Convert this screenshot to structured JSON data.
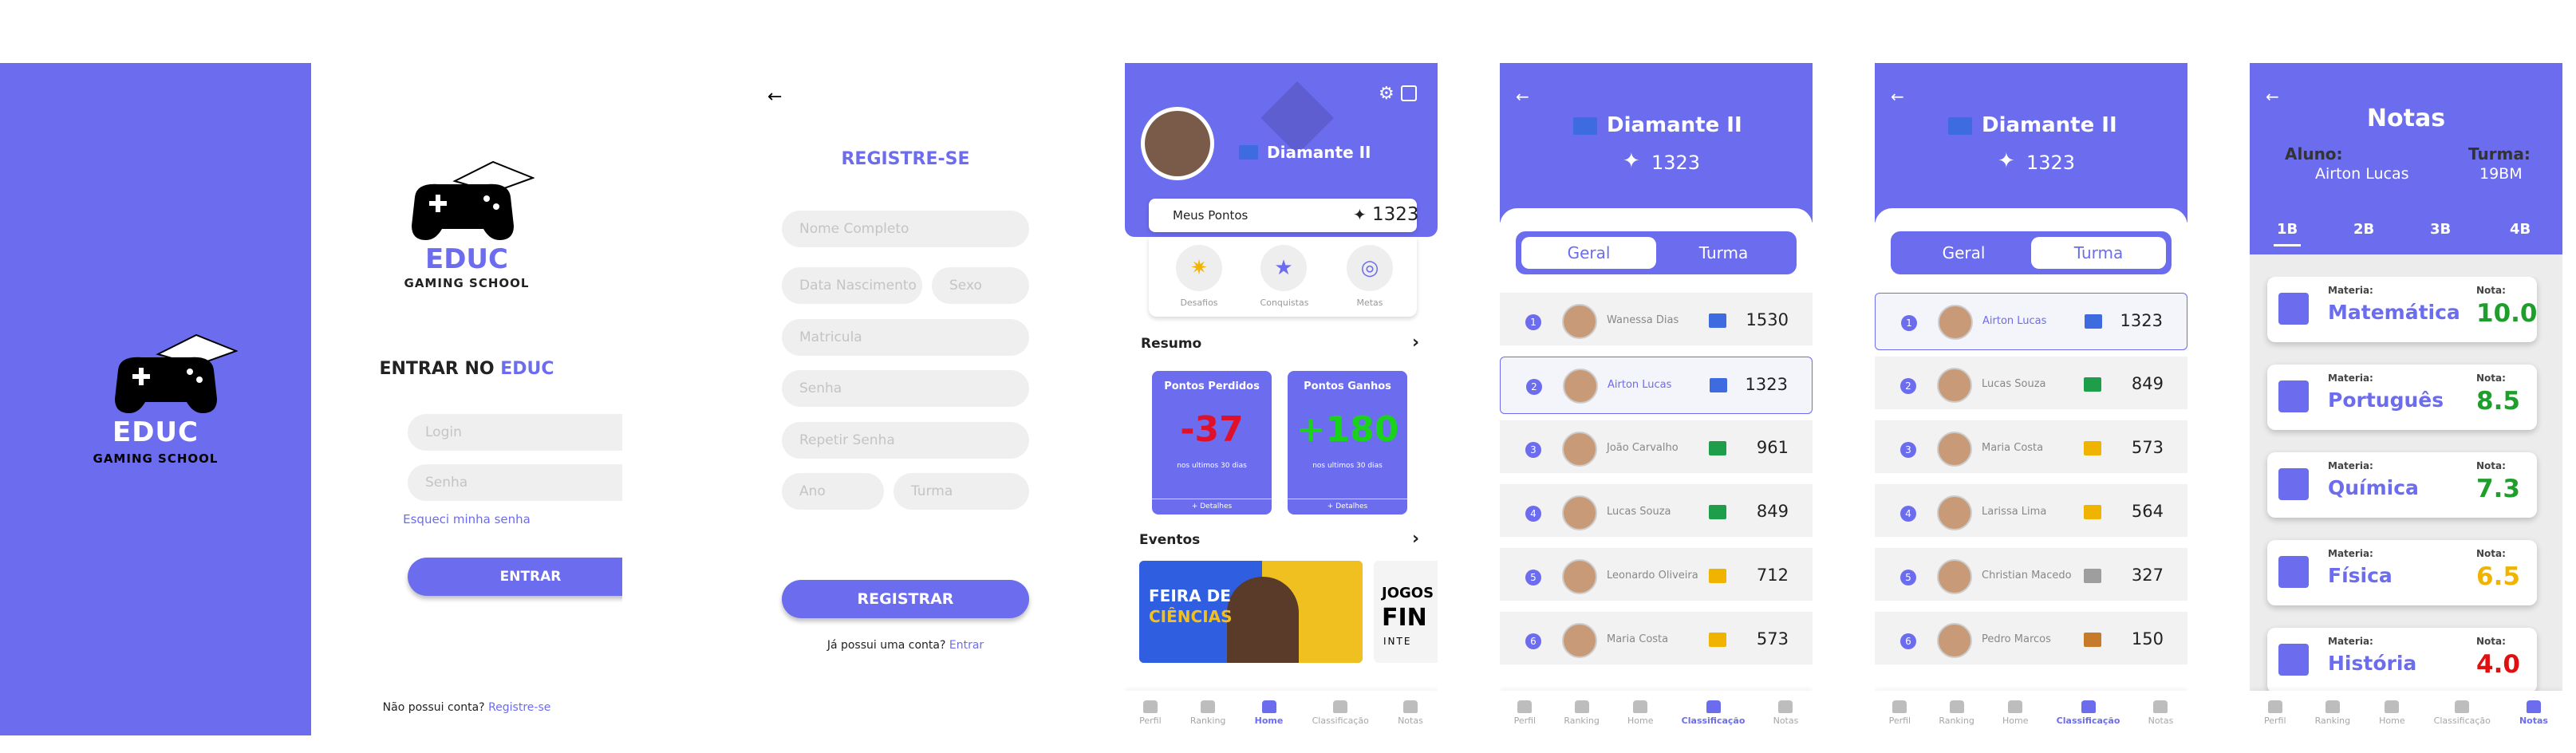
{
  "splash": {
    "brand": "EDUC",
    "tagline": "GAMING SCHOOL"
  },
  "login": {
    "brand": "EDUC",
    "tagline": "GAMING SCHOOL",
    "heading_prefix": "ENTRAR NO ",
    "heading_brand": "EDUC",
    "login_placeholder": "Login",
    "password_placeholder": "Senha",
    "forgot": "Esqueci minha senha",
    "submit": "ENTRAR",
    "no_account": "Não possui conta?",
    "register_link": "Registre-se"
  },
  "register": {
    "title": "REGISTRE-SE",
    "fields": {
      "name": "Nome Completo",
      "birth": "Data Nascimento",
      "sex": "Sexo",
      "matricula": "Matricula",
      "password": "Senha",
      "repeat": "Repetir Senha",
      "year": "Ano",
      "class": "Turma"
    },
    "submit": "REGISTRAR",
    "have_account": "Já possui uma conta?",
    "enter_link": "Entrar"
  },
  "home": {
    "rank": "Diamante II",
    "points_label": "Meus Pontos",
    "points": "1323",
    "shortcuts": [
      "Desafios",
      "Conquistas",
      "Metas"
    ],
    "summary_title": "Resumo",
    "lost": {
      "title": "Pontos Perdidos",
      "value": "-37",
      "caption": "nos ultimos 30 dias",
      "link": "+ Detalhes"
    },
    "gained": {
      "title": "Pontos Ganhos",
      "value": "+180",
      "caption": "nos ultimos 30 dias",
      "link": "+ Detalhes"
    },
    "events_title": "Eventos",
    "event1_line1": "FEIRA DE",
    "event1_line2": "CIÊNCIAS",
    "event2_line1": "JOGOS",
    "event2_line2": "FIN",
    "event2_line3": "INTE"
  },
  "nav": [
    "Perfil",
    "Ranking",
    "Home",
    "Classificação",
    "Notas"
  ],
  "ranking_geral": {
    "title": "Diamante II",
    "points": "1323",
    "tabs": [
      "Geral",
      "Turma"
    ],
    "rows": [
      {
        "rank": "1",
        "name": "Wanessa Dias",
        "score": "1530",
        "book": "#3f6be0"
      },
      {
        "rank": "2",
        "name": "Airton Lucas",
        "score": "1323",
        "book": "#3f6be0"
      },
      {
        "rank": "3",
        "name": "João Carvalho",
        "score": "961",
        "book": "#1e9e4a"
      },
      {
        "rank": "4",
        "name": "Lucas Souza",
        "score": "849",
        "book": "#1e9e4a"
      },
      {
        "rank": "5",
        "name": "Leonardo Oliveira",
        "score": "712",
        "book": "#f0b400"
      },
      {
        "rank": "6",
        "name": "Maria Costa",
        "score": "573",
        "book": "#f0b400"
      }
    ]
  },
  "ranking_turma": {
    "title": "Diamante II",
    "points": "1323",
    "tabs": [
      "Geral",
      "Turma"
    ],
    "rows": [
      {
        "rank": "1",
        "name": "Airton Lucas",
        "score": "1323",
        "book": "#3f6be0"
      },
      {
        "rank": "2",
        "name": "Lucas Souza",
        "score": "849",
        "book": "#1e9e4a"
      },
      {
        "rank": "3",
        "name": "Maria Costa",
        "score": "573",
        "book": "#f0b400"
      },
      {
        "rank": "4",
        "name": "Larissa Lima",
        "score": "564",
        "book": "#f0b400"
      },
      {
        "rank": "5",
        "name": "Christian Macedo",
        "score": "327",
        "book": "#9e9e9e"
      },
      {
        "rank": "6",
        "name": "Pedro Marcos",
        "score": "150",
        "book": "#c77a2a"
      }
    ]
  },
  "notas": {
    "title": "Notas",
    "student_label": "Aluno:",
    "student": "Airton Lucas",
    "class_label": "Turma:",
    "class": "19BM",
    "terms": [
      "1B",
      "2B",
      "3B",
      "4B"
    ],
    "subject_label": "Materia:",
    "grade_label": "Nota:",
    "cards": [
      {
        "subject": "Matemática",
        "grade": "10.0",
        "color": "#1e9e2a"
      },
      {
        "subject": "Português",
        "grade": "8.5",
        "color": "#1e9e2a"
      },
      {
        "subject": "Química",
        "grade": "7.3",
        "color": "#1e9e2a"
      },
      {
        "subject": "Física",
        "grade": "6.5",
        "color": "#f0b400"
      },
      {
        "subject": "História",
        "grade": "4.0",
        "color": "#e01010"
      }
    ]
  },
  "colors": {
    "primary": "#6c6cef",
    "lost": "#e0102a",
    "gained": "#19d219"
  }
}
